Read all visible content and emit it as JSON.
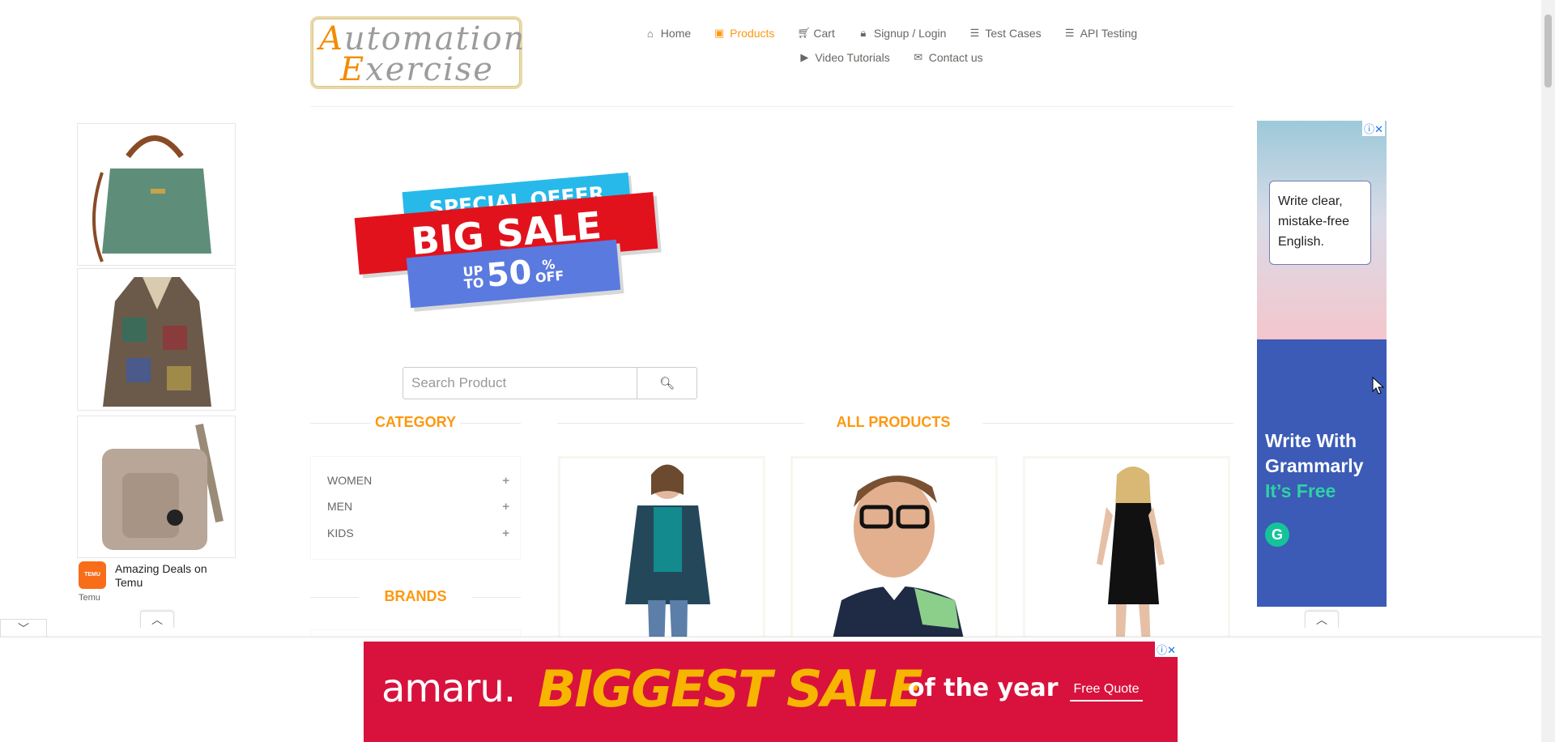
{
  "logo": {
    "line1_cap": "A",
    "line1_rest": "utomation",
    "line2_cap": "E",
    "line2_rest": "xercise"
  },
  "nav": {
    "items": [
      {
        "label": "Home",
        "icon": "home-icon",
        "active": false
      },
      {
        "label": "Products",
        "icon": "shopping-bag-icon",
        "active": true
      },
      {
        "label": "Cart",
        "icon": "cart-icon",
        "active": false
      },
      {
        "label": "Signup / Login",
        "icon": "lock-icon",
        "active": false
      },
      {
        "label": "Test Cases",
        "icon": "list-icon",
        "active": false
      },
      {
        "label": "API Testing",
        "icon": "list-icon",
        "active": false
      },
      {
        "label": "Video Tutorials",
        "icon": "youtube-icon",
        "active": false
      },
      {
        "label": "Contact us",
        "icon": "envelope-icon",
        "active": false
      }
    ]
  },
  "banner": {
    "line1": "SPECIAL OFFER",
    "line2": "BIG SALE",
    "up": "UP",
    "to": "TO",
    "pct": "50",
    "pct_sign": "%",
    "off": "OFF"
  },
  "search": {
    "placeholder": "Search Product",
    "value": ""
  },
  "category": {
    "title": "CATEGORY",
    "items": [
      {
        "label": "WOMEN"
      },
      {
        "label": "MEN"
      },
      {
        "label": "KIDS"
      }
    ]
  },
  "brands": {
    "title": "BRANDS"
  },
  "products": {
    "title": "ALL PRODUCTS"
  },
  "ad_left": {
    "text": "Amazing Deals on Temu",
    "brand": "Temu",
    "logo_text": "TEMU"
  },
  "ad_right": {
    "card_text": "Write clear, mistake-free English.",
    "headline_1": "Write With",
    "headline_2": "Grammarly",
    "headline_3": "It’s Free",
    "logo_letter": "G"
  },
  "ad_bottom": {
    "brand": "amaru.",
    "headline": "BIGGEST SALE",
    "tail": "of the year",
    "cta": "Free Quote"
  },
  "colors": {
    "accent": "#FE980F",
    "text": "#696763",
    "grammarly_bg": "#3b5bb7",
    "amaru_bg": "#d8123d",
    "temu": "#f86d1a"
  }
}
